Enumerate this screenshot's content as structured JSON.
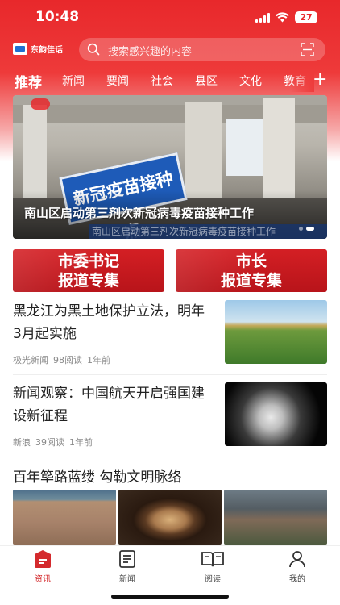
{
  "status_bar": {
    "time": "10:48",
    "battery": "27"
  },
  "brand": {
    "logo_text": "东韵佳话"
  },
  "search": {
    "placeholder": "搜索感兴趣的内容"
  },
  "categories": [
    "推荐",
    "新闻",
    "要闻",
    "社会",
    "县区",
    "文化",
    "教育"
  ],
  "banner": {
    "caption": "南山区启动第三剂次新冠病毒疫苗接种工作",
    "sign_text": "新冠疫苗接种点",
    "strip_text": "南山区启动第三剂次新冠病毒疫苗接种工作"
  },
  "special_reports": [
    {
      "line1": "市委书记",
      "line2": "报道专集"
    },
    {
      "line1": "市长",
      "line2": "报道专集"
    }
  ],
  "news": [
    {
      "title": "黑龙江为黑土地保护立法，明年3月起实施",
      "source": "极光新闻",
      "reads": "98阅读",
      "time": "1年前"
    },
    {
      "title": "新闻观察：中国航天开启强国建设新征程",
      "source": "新浪",
      "reads": "39阅读",
      "time": "1年前"
    }
  ],
  "section": {
    "title": "百年筚路蓝缕 勾勒文明脉络"
  },
  "tabbar": [
    {
      "label": "资讯",
      "icon": "news-feed-icon"
    },
    {
      "label": "新闻",
      "icon": "newspaper-icon"
    },
    {
      "label": "阅读",
      "icon": "open-book-icon"
    },
    {
      "label": "我的",
      "icon": "person-icon"
    }
  ],
  "colors": {
    "brand_red": "#e8282b",
    "active_tab": "#d42a2d"
  }
}
